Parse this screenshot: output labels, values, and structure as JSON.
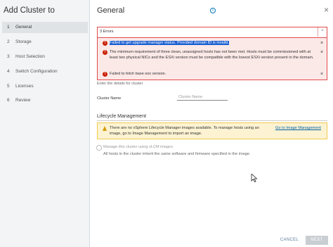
{
  "wizard": {
    "title": "Add Cluster to",
    "steps": [
      {
        "num": "1",
        "label": "General"
      },
      {
        "num": "2",
        "label": "Storage"
      },
      {
        "num": "3",
        "label": "Host Selection"
      },
      {
        "num": "4",
        "label": "Switch Configuration"
      },
      {
        "num": "5",
        "label": "Licenses"
      },
      {
        "num": "6",
        "label": "Review"
      }
    ],
    "active_step": 1
  },
  "page": {
    "title": "General",
    "help_glyph": "i",
    "close_glyph": "×"
  },
  "errors": {
    "count_label": "3 Errors",
    "collapse_glyph": "^",
    "items": [
      {
        "text": "Failed to get upgrade manager status. Provided domain ID is invalid."
      },
      {
        "text": "The minimum requirement of three clean, unassigned hosts has not been met. Hosts must be commissioned with at least two physical NICs and the ESXi version must be compatible with the lowest ESXi version present in the domain."
      },
      {
        "text": "Failed to fetch base esx version."
      }
    ],
    "icon_glyph": "!",
    "dismiss_glyph": "×"
  },
  "form": {
    "hint": "Enter the details for cluster",
    "cluster_name_label": "Cluster Name",
    "cluster_name_placeholder": "Cluster Name",
    "cluster_name_value": ""
  },
  "lifecycle": {
    "title": "Lifecycle Management",
    "warning_text": "There are no vSphere Lifecycle Manager images available. To manage hosts using an image, go to Image Management to import an image.",
    "warning_link": "Go to Image Management",
    "vlcm_label": "Manage this cluster using vLCM images",
    "vlcm_sub": "All hosts in the cluster inherit the same software and firmware specified in the image."
  },
  "footer": {
    "cancel_label": "CANCEL",
    "next_label": "NEXT"
  },
  "colors": {
    "error": "#c92100",
    "warning": "#d69b00",
    "link": "#0060a8",
    "selection": "#1a5fd1"
  }
}
